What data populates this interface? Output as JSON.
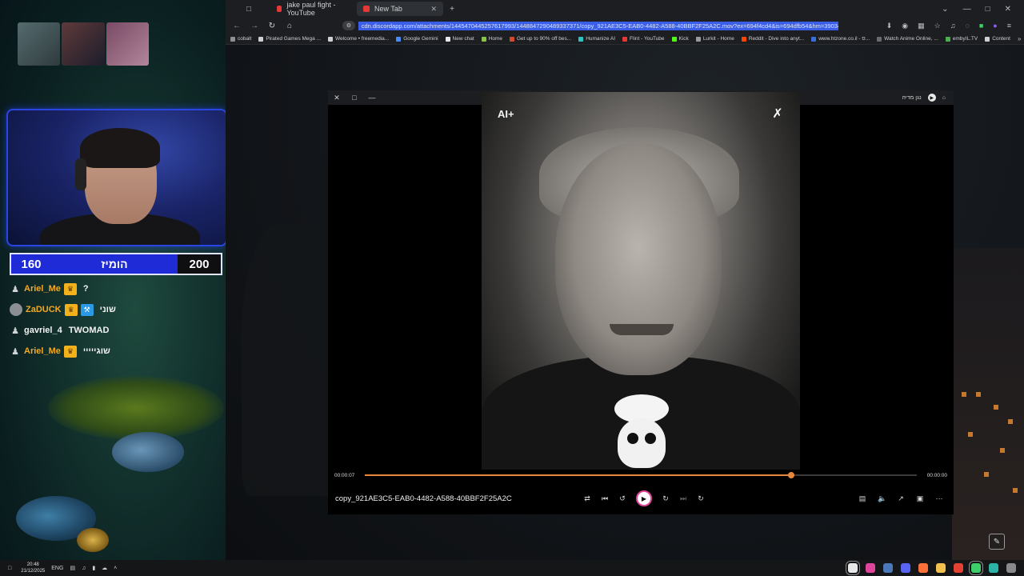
{
  "overlay": {
    "scorebar": {
      "left_score": "160",
      "title": "הומיז",
      "right_score": "200"
    },
    "chat": [
      {
        "user": "Ariel_Me",
        "message": "?",
        "badge": "crown"
      },
      {
        "user": "ZaDUCK",
        "message": "שוני",
        "badge": "crown"
      },
      {
        "user": "gavriel_4",
        "message": "TWOMAD",
        "badge": ""
      },
      {
        "user": "Ariel_Me",
        "message": "שוגייייי",
        "badge": "crown"
      }
    ]
  },
  "browser": {
    "tabs": [
      {
        "label": "jake paul fight - YouTube",
        "favicon_color": "#e53935"
      },
      {
        "label": "New Tab",
        "favicon_color": "#e53935"
      }
    ],
    "url": "cdn.discordapp.com/attachments/1445470445257617993/1448847290489337371/copy_921AE3C5-EAB0-4482-A588-40BBF2F25A2C.mov?ex=694f4cd4&is=694dfb54&hm=39034d43c0e3f03c855b4d",
    "bookmarks": [
      {
        "label": "cobalt",
        "color": "#8f8f8f"
      },
      {
        "label": "Pirated Games Mega ...",
        "color": "#cfcfcf"
      },
      {
        "label": "Welcome • freemedia...",
        "color": "#cfcfcf"
      },
      {
        "label": "Google Gemini",
        "color": "#4a8cf7"
      },
      {
        "label": "New chat",
        "color": "#e8e8e8"
      },
      {
        "label": "Home",
        "color": "#8bc34a"
      },
      {
        "label": "Get up to 90% off bes...",
        "color": "#d24b2c"
      },
      {
        "label": "Humanize AI",
        "color": "#2fc4c4"
      },
      {
        "label": "Flint - YouTube",
        "color": "#e53935"
      },
      {
        "label": "Kick",
        "color": "#53fc18"
      },
      {
        "label": "Lurkit - Home",
        "color": "#9a9a9a"
      },
      {
        "label": "Reddit - Dive into anyt...",
        "color": "#ff4500"
      },
      {
        "label": "www.htzone.co.il - ס...",
        "color": "#3a6fd8"
      },
      {
        "label": "Watch Anime Online, ...",
        "color": "#6a6a6a"
      },
      {
        "label": "embyIL.TV",
        "color": "#4caf50"
      },
      {
        "label": "Content",
        "color": "#cfcfcf"
      }
    ]
  },
  "player": {
    "header_right_label": "נגן מדיה",
    "watermark_left": "AI+",
    "elapsed": "00:00:07",
    "total": "00:00:00",
    "progress": 0.773,
    "filename": "copy_921AE3C5-EAB0-4482-A588-40BBF2F25A2C"
  },
  "taskbar": {
    "language": "ENG",
    "time": "20:48",
    "date": "21/12/2025",
    "apps": [
      {
        "name": "media-player",
        "color": "#e8e8e8",
        "active": true
      },
      {
        "name": "player-pink",
        "color": "#e0459b",
        "active": false
      },
      {
        "name": "steam",
        "color": "#4a78b8",
        "active": false
      },
      {
        "name": "discord",
        "color": "#5865f2",
        "active": false
      },
      {
        "name": "firefox",
        "color": "#ff7139",
        "active": false
      },
      {
        "name": "file-explorer",
        "color": "#f2c14e",
        "active": false
      },
      {
        "name": "chrome",
        "color": "#e34133",
        "active": false
      },
      {
        "name": "browser-green",
        "color": "#3ecf6b",
        "active": true
      },
      {
        "name": "app-teal",
        "color": "#2ab3a6",
        "active": false
      },
      {
        "name": "app-grey",
        "color": "#8a8a8a",
        "active": false
      }
    ]
  }
}
